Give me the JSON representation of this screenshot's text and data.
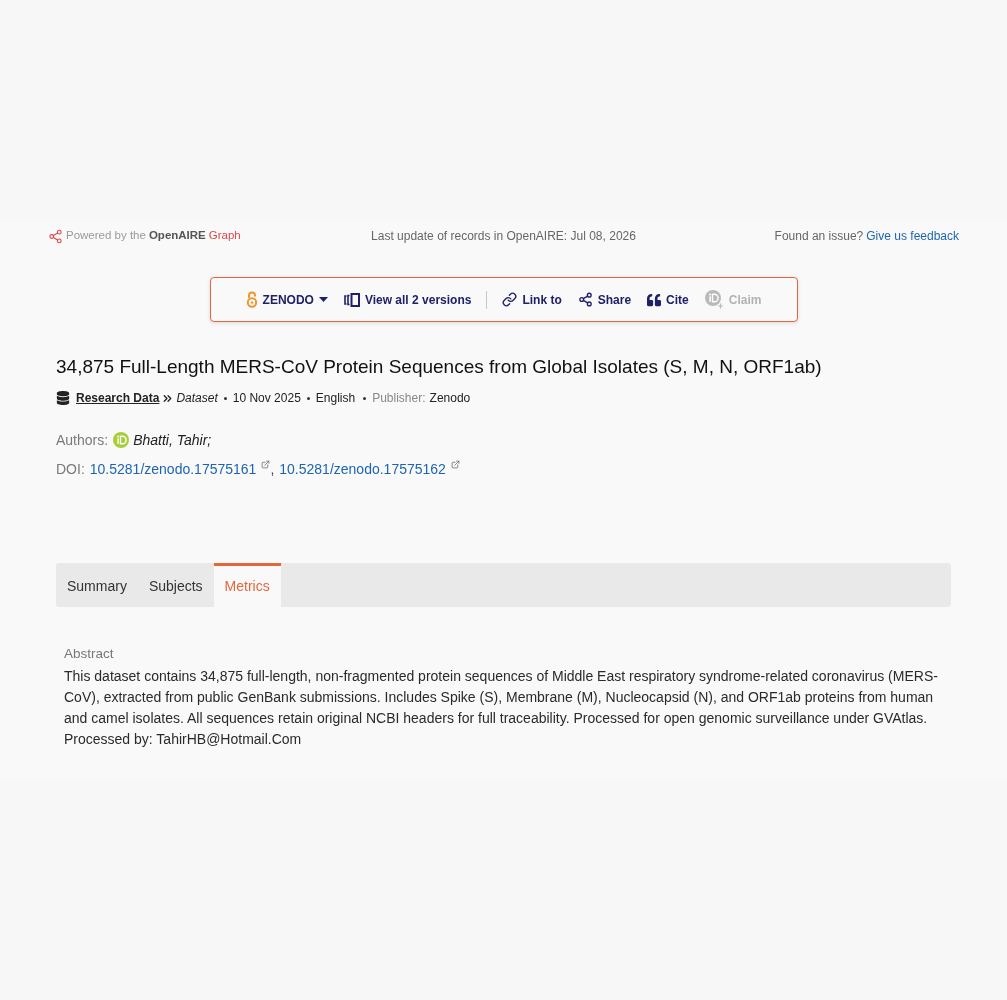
{
  "header": {
    "powered_by": {
      "prefix": "Powered by the",
      "brand": "OpenAIRE",
      "suffix": "Graph"
    },
    "last_update": "Last update of records in OpenAIRE: Jul 08, 2026",
    "feedback": {
      "prompt": "Found an issue?",
      "link": "Give us feedback"
    }
  },
  "actions": [
    {
      "items": [
        {
          "kind": "source",
          "label": "ZENODO",
          "disabled": false
        },
        {
          "kind": "versions",
          "label": "View all 2 versions",
          "disabled": false
        }
      ]
    },
    {
      "items": [
        {
          "kind": "link",
          "label": "Link to",
          "disabled": false
        },
        {
          "kind": "share",
          "label": "Share",
          "disabled": false
        },
        {
          "kind": "cite",
          "label": "Cite",
          "disabled": false
        },
        {
          "kind": "claim",
          "label": "Claim",
          "disabled": true
        }
      ]
    }
  ],
  "record": {
    "title": "34,875 Full-Length MERS-CoV Protein Sequences from Global Isolates (S, M, N, ORF1ab)",
    "type": "Research Data",
    "subtype": "Dataset",
    "date": "10 Nov 2025",
    "language": "English",
    "publisher_label": "Publisher:",
    "publisher": "Zenodo"
  },
  "authors": {
    "label": "Authors:",
    "items": [
      {
        "name": "Bhatti, Tahir;",
        "orcid": true
      }
    ]
  },
  "doi": {
    "label": "DOI:",
    "separator": ",",
    "links": [
      "10.5281/zenodo.17575161",
      "10.5281/zenodo.17575162"
    ]
  },
  "tabs": [
    {
      "label": "Summary",
      "selected": false
    },
    {
      "label": "Subjects",
      "selected": false
    },
    {
      "label": "Metrics",
      "selected": true
    }
  ],
  "abstract": {
    "heading": "Abstract",
    "text": "This dataset contains 34,875 full-length, non-fragmented protein sequences of Middle East respiratory syndrome-related coronavirus (MERS-CoV), extracted from public GenBank submissions. Includes Spike (S), Membrane (M), Nucleocapsid (N), and ORF1ab proteins from human and camel isolates. All sequences retain original NCBI headers for full traceability. Processed for open genomic surveillance under GVAtlas.",
    "processed_by": "Processed by: TahirHB@Hotmail.Com"
  }
}
